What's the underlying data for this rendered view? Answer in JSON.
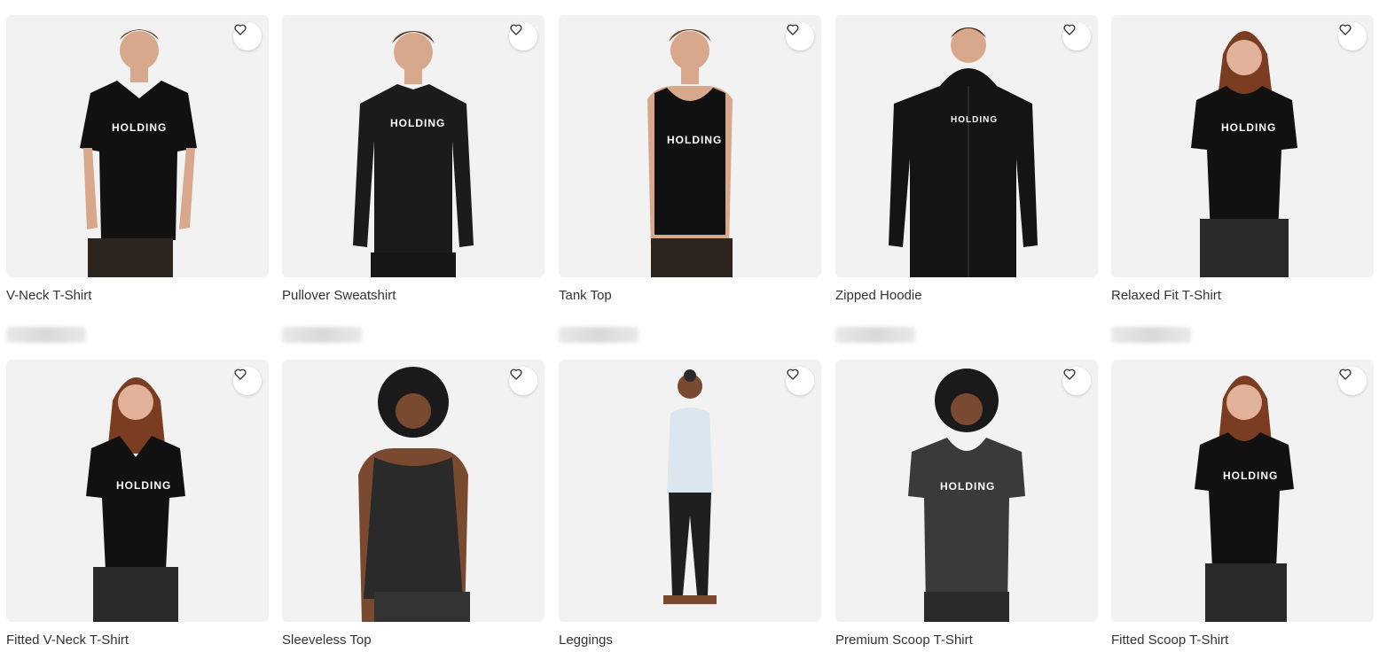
{
  "products": [
    {
      "title": "V-Neck T-Shirt",
      "print": "HOLDING",
      "price": ""
    },
    {
      "title": "Pullover Sweatshirt",
      "print": "HOLDING",
      "price": ""
    },
    {
      "title": "Tank Top",
      "print": "HOLDING",
      "price": ""
    },
    {
      "title": "Zipped Hoodie",
      "print": "HOLDING",
      "price": ""
    },
    {
      "title": "Relaxed Fit T-Shirt",
      "print": "HOLDING",
      "price": ""
    },
    {
      "title": "Fitted V-Neck T-Shirt",
      "print": "HOLDING",
      "price": ""
    },
    {
      "title": "Sleeveless Top",
      "print": "",
      "price": ""
    },
    {
      "title": "Leggings",
      "print": "",
      "price": ""
    },
    {
      "title": "Premium Scoop T-Shirt",
      "print": "HOLDING",
      "price": ""
    },
    {
      "title": "Fitted Scoop T-Shirt",
      "print": "HOLDING",
      "price": ""
    }
  ],
  "icons": {
    "favorite": "heart-outline-icon"
  },
  "colors": {
    "text": "#333333",
    "background": "#ffffff",
    "thumb_bg": "#f2f2f2"
  }
}
